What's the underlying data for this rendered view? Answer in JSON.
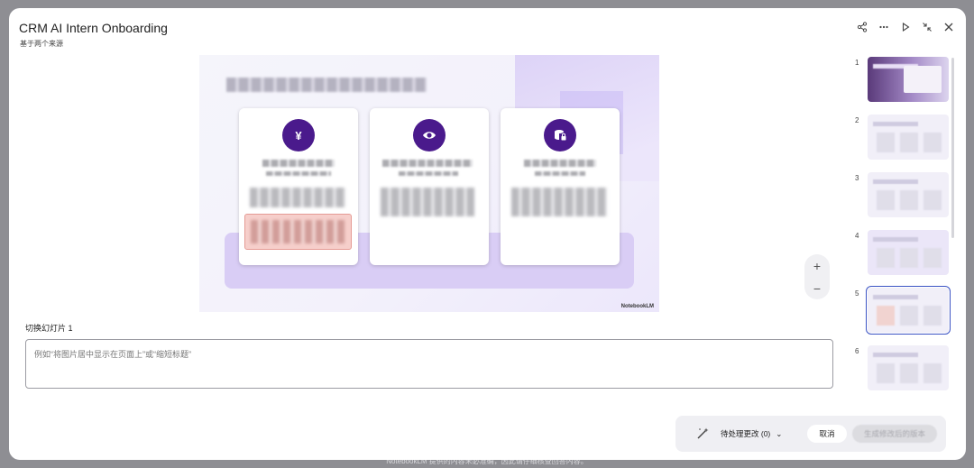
{
  "window": {
    "title": "CRM AI Intern Onboarding",
    "subtitle": "基于两个来源"
  },
  "toolbar": {
    "icons": [
      "share-icon",
      "more-icon",
      "play-icon",
      "collapse-icon",
      "close-icon"
    ]
  },
  "slide": {
    "footer_logo": "NotebookLM",
    "card_icons": [
      "yen-icon",
      "eye-icon",
      "database-lock-icon"
    ]
  },
  "zoom": {
    "plus": "+",
    "minus": "−"
  },
  "thumbnails": [
    {
      "number": "1"
    },
    {
      "number": "2"
    },
    {
      "number": "3"
    },
    {
      "number": "4"
    },
    {
      "number": "5",
      "active": true
    },
    {
      "number": "6"
    }
  ],
  "edit": {
    "label": "切换幻灯片 1",
    "placeholder": "例如“将图片居中显示在页面上”或“缩短标题”"
  },
  "actions": {
    "pending_label": "待处理更改 (0)",
    "cancel_label": "取消",
    "generate_label": "生成修改后的版本"
  },
  "footer": {
    "disclaimer": "NotebookLM 提供的内容未必准确，因此请仔细核查回答内容。"
  },
  "colors": {
    "accent": "#3b53c4",
    "card_icon_bg": "#4a1a8c",
    "band": "#d9cdf5"
  }
}
